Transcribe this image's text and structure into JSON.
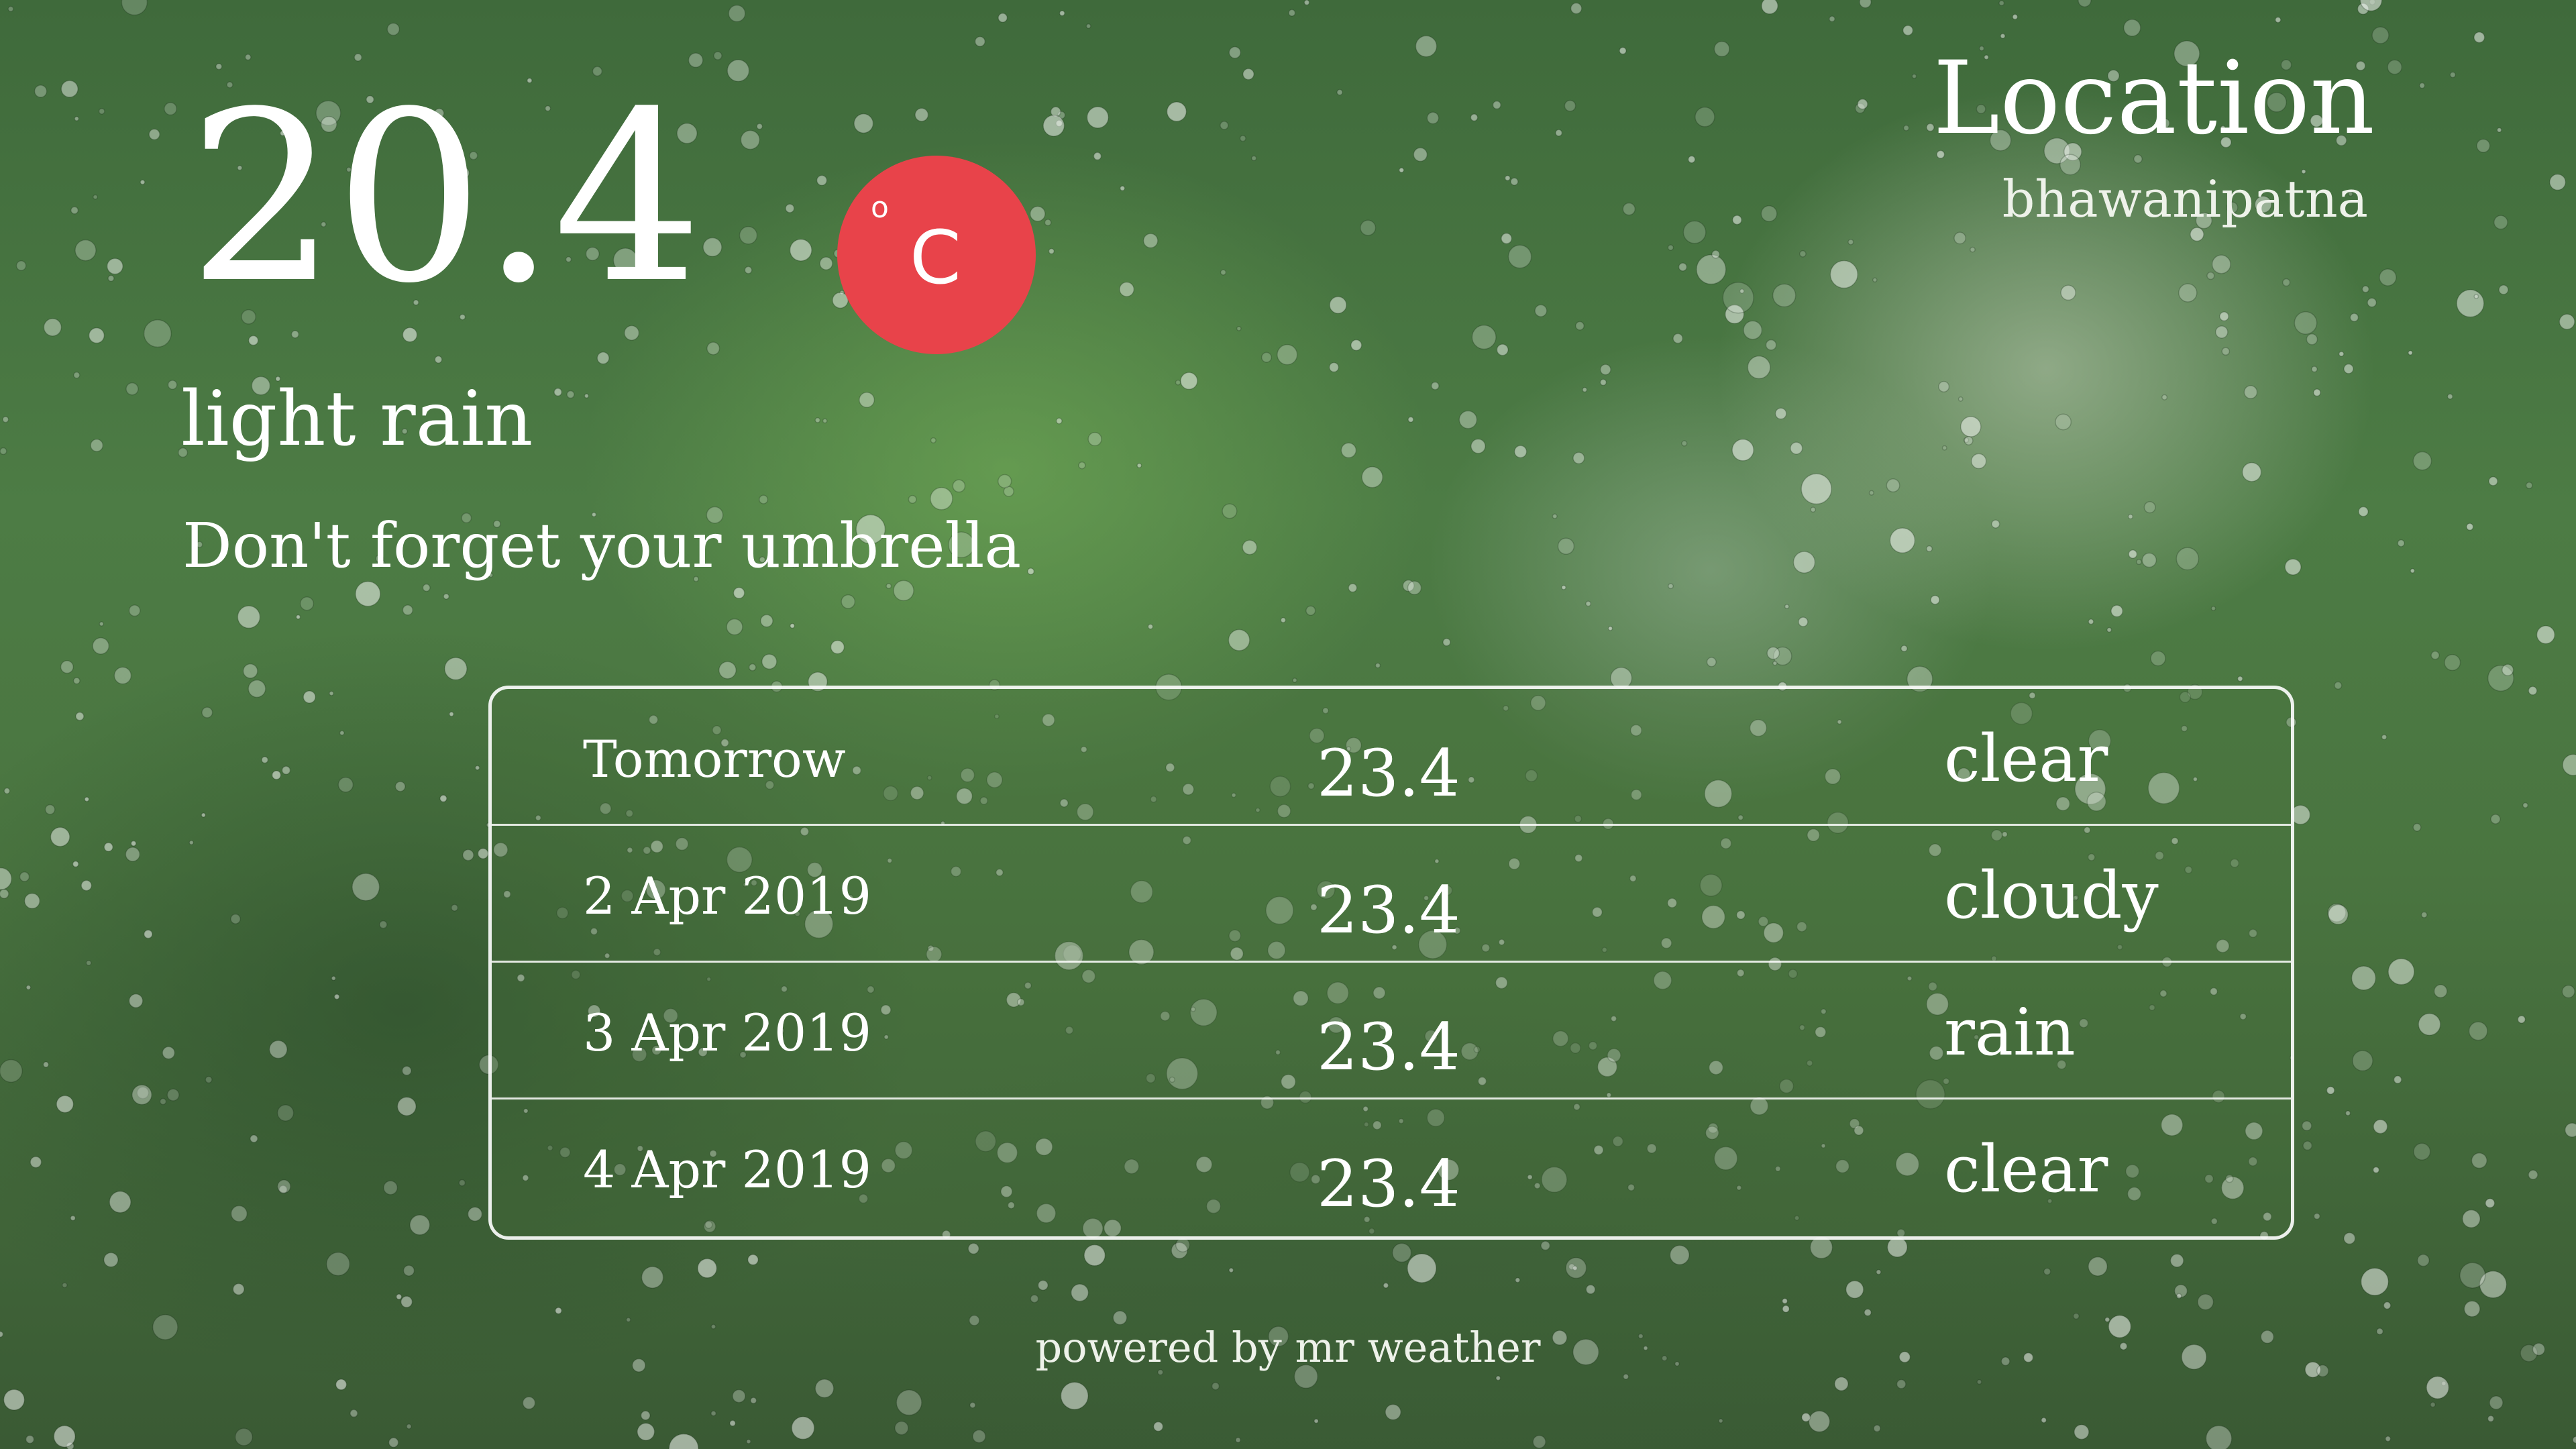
{
  "current": {
    "temperature": "20.4",
    "unit_degree": "o",
    "unit_letter": "C",
    "condition": "light rain",
    "tip": "Don't forget your umbrella"
  },
  "location": {
    "title": "Location",
    "name": "bhawanipatna"
  },
  "forecast": [
    {
      "date": "Tomorrow",
      "temp": "23.4",
      "condition": "clear"
    },
    {
      "date": "2 Apr 2019",
      "temp": "23.4",
      "condition": "cloudy"
    },
    {
      "date": "3 Apr 2019",
      "temp": "23.4",
      "condition": "rain"
    },
    {
      "date": "4 Apr 2019",
      "temp": "23.4",
      "condition": "clear"
    }
  ],
  "footer": "powered by mr weather",
  "colors": {
    "unit_badge": "#e8434a",
    "table_border": "#ffffff"
  }
}
